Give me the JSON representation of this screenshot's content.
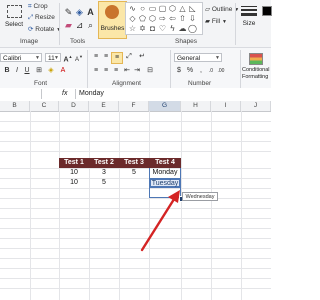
{
  "paint_ribbon": {
    "select_label": "Select",
    "crop_label": "Crop",
    "resize_label": "Resize",
    "rotate_label": "Rotate",
    "image_group": "Image",
    "tools_group": "Tools",
    "brushes_label": "Brushes",
    "shapes_group": "Shapes",
    "outline_label": "Outline",
    "fill_label": "Fill",
    "size_label": "Size"
  },
  "excel_ribbon": {
    "font_name": "Calibri",
    "font_size": "11",
    "number_format": "General",
    "font_group": "Font",
    "alignment_group": "Alignment",
    "number_group": "Number",
    "conditional_label_1": "Conditional",
    "conditional_label_2": "Formatting"
  },
  "formula_bar": {
    "name_box": "G4",
    "fx": "fx",
    "value": "Monday"
  },
  "sheet": {
    "columns": [
      "B",
      "C",
      "D",
      "E",
      "F",
      "G",
      "H",
      "I",
      "J"
    ],
    "selected_column": "G",
    "headers": [
      "Test 1",
      "Test 2",
      "Test 3",
      "Test 4"
    ],
    "rows": [
      [
        "10",
        "3",
        "5",
        "Monday"
      ],
      [
        "10",
        "5",
        "",
        "Tuesday"
      ]
    ],
    "autofill_tooltip": "Wednesday"
  },
  "colors": {
    "header_fill": "#6b2a2b",
    "selection": "#4d77b5",
    "arrow": "#d42424"
  }
}
